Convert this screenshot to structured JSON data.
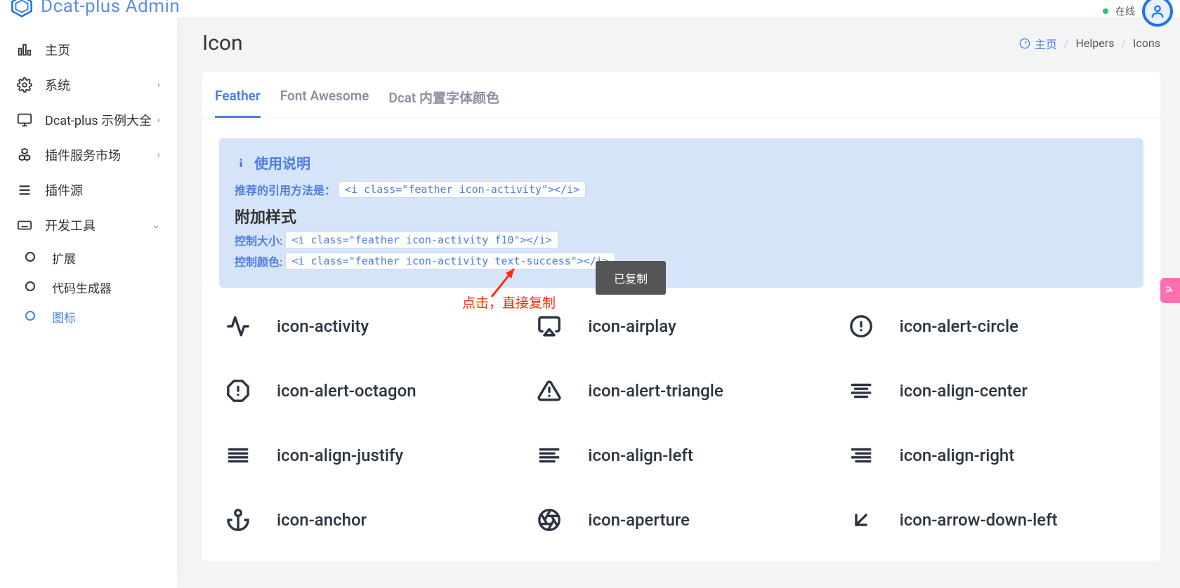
{
  "brand": {
    "name": "Dcat-plus Admin"
  },
  "topbar": {
    "online": "在线"
  },
  "sidebar": {
    "items": [
      {
        "label": "主页",
        "icon": "home"
      },
      {
        "label": "系统",
        "icon": "gear",
        "expandable": true
      },
      {
        "label": "Dcat-plus 示例大全",
        "icon": "monitor",
        "expandable": true
      },
      {
        "label": "插件服务市场",
        "icon": "cubes",
        "expandable": true
      },
      {
        "label": "插件源",
        "icon": "list"
      },
      {
        "label": "开发工具",
        "icon": "keyboard",
        "expandable": true,
        "expanded": true
      }
    ],
    "dev_children": [
      {
        "label": "扩展"
      },
      {
        "label": "代码生成器"
      },
      {
        "label": "图标",
        "active": true
      }
    ]
  },
  "page": {
    "title": "Icon",
    "breadcrumb": {
      "home": "主页",
      "mid": "Helpers",
      "last": "Icons"
    }
  },
  "tabs": [
    {
      "label": "Feather",
      "active": true
    },
    {
      "label": "Font Awesome"
    },
    {
      "label": "Dcat 内置字体颜色"
    }
  ],
  "info": {
    "title": "使用说明",
    "rec_label": "推荐的引用方法是：",
    "rec_code": "<i class=\"feather icon-activity\"></i>",
    "extra_title": "附加样式",
    "size_label": "控制大小:",
    "size_code": "<i class=\"feather icon-activity f10\"></i>",
    "color_label": "控制颜色:",
    "color_code": "<i class=\"feather icon-activity text-success\"></i>"
  },
  "tooltip": "已复制",
  "annotation": "点击，直接复制",
  "icons": [
    {
      "name": "icon-activity",
      "glyph": "activity"
    },
    {
      "name": "icon-airplay",
      "glyph": "airplay"
    },
    {
      "name": "icon-alert-circle",
      "glyph": "alert-circle"
    },
    {
      "name": "icon-alert-octagon",
      "glyph": "alert-octagon"
    },
    {
      "name": "icon-alert-triangle",
      "glyph": "alert-triangle"
    },
    {
      "name": "icon-align-center",
      "glyph": "align-center"
    },
    {
      "name": "icon-align-justify",
      "glyph": "align-justify"
    },
    {
      "name": "icon-align-left",
      "glyph": "align-left"
    },
    {
      "name": "icon-align-right",
      "glyph": "align-right"
    },
    {
      "name": "icon-anchor",
      "glyph": "anchor"
    },
    {
      "name": "icon-aperture",
      "glyph": "aperture"
    },
    {
      "name": "icon-arrow-down-left",
      "glyph": "arrow-down-left"
    }
  ]
}
